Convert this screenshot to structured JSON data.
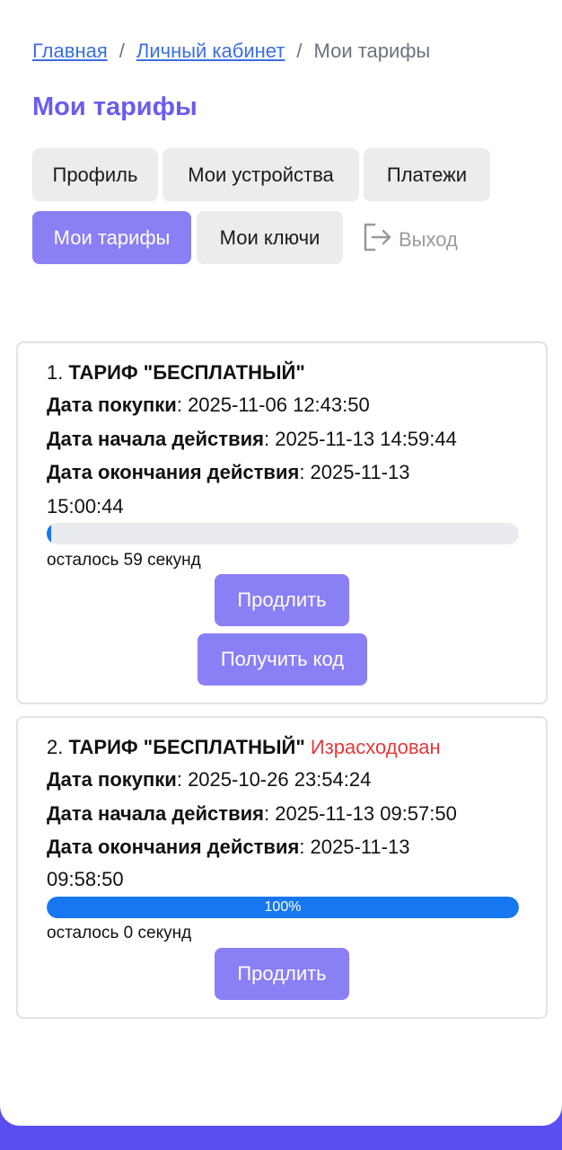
{
  "breadcrumb": {
    "home": "Главная",
    "separator": "/",
    "account": "Личный кабинет",
    "current": "Мои тарифы"
  },
  "page_title": "Мои тарифы",
  "tabs": [
    {
      "label": "Профиль",
      "active": false
    },
    {
      "label": "Мои устройства",
      "active": false
    },
    {
      "label": "Платежи",
      "active": false
    },
    {
      "label": "Мои тарифы",
      "active": true
    },
    {
      "label": "Мои ключи",
      "active": false
    }
  ],
  "logout": {
    "label": "Выход",
    "icon": "logout-icon"
  },
  "tariffs": [
    {
      "number": "1.",
      "name": "ТАРИФ \"БЕСПЛАТНЫЙ\"",
      "status": "",
      "purchase_label": "Дата покупки",
      "purchase_date": "2025-11-06 12:43:50",
      "start_label": "Дата начала действия",
      "start_date": "2025-11-13 14:59:44",
      "end_label": "Дата окончания действия",
      "end_date_part1": "2025-11-13",
      "end_date_part2": "15:00:44",
      "progress_fraction": 0.01,
      "progress_text": "",
      "remaining": "осталось 59 секунд",
      "extend_label": "Продлить",
      "get_code_label": "Получить код"
    },
    {
      "number": "2.",
      "name": "ТАРИФ \"БЕСПЛАТНЫЙ\"",
      "status": "Израсходован",
      "purchase_label": "Дата покупки",
      "purchase_date": "2025-10-26 23:54:24",
      "start_label": "Дата начала действия",
      "start_date": "2025-11-13 09:57:50",
      "end_label": "Дата окончания действия",
      "end_date_part1": "2025-11-13",
      "end_date_part2": "09:58:50",
      "progress_fraction": 1.0,
      "progress_text": "100%",
      "remaining": "осталось 0 секунд",
      "extend_label": "Продлить"
    }
  ],
  "colors": {
    "accent": "#8a7ff5",
    "title": "#6a5cf0",
    "link": "#3b6fe0",
    "progress": "#1677f0",
    "status_expired": "#e03a3a",
    "footer": "#5b4ef0"
  }
}
